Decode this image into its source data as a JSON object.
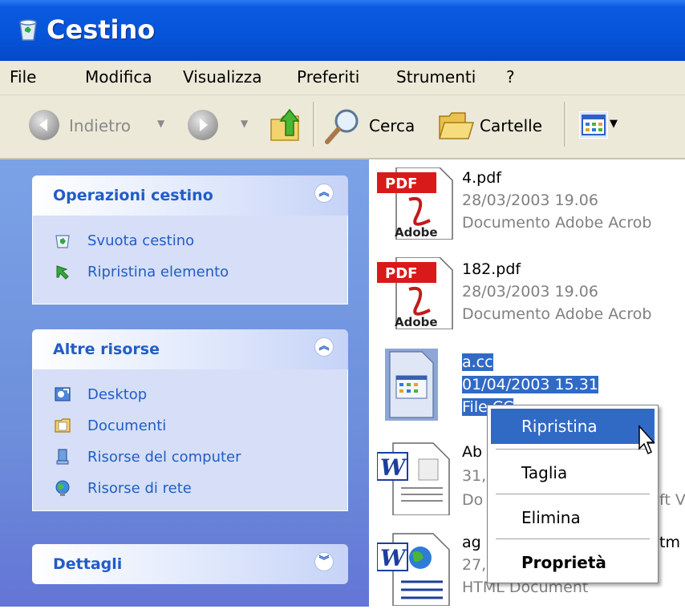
{
  "window": {
    "title": "Cestino"
  },
  "menu": [
    "File",
    "Modifica",
    "Visualizza",
    "Preferiti",
    "Strumenti",
    "?"
  ],
  "toolbar": {
    "back": "Indietro",
    "search": "Cerca",
    "folders": "Cartelle"
  },
  "panels": {
    "recycle": {
      "title": "Operazioni cestino",
      "tasks": [
        "Svuota cestino",
        "Ripristina elemento"
      ]
    },
    "other": {
      "title": "Altre risorse",
      "links": [
        "Desktop",
        "Documenti",
        "Risorse del computer",
        "Risorse di rete"
      ]
    },
    "details": {
      "title": "Dettagli"
    }
  },
  "files": [
    {
      "name": "4.pdf",
      "date": "28/03/2003 19.06",
      "type": "Documento Adobe Acrob"
    },
    {
      "name": "182.pdf",
      "date": "28/03/2003 19.06",
      "type": "Documento Adobe Acrob"
    },
    {
      "name": "a.cc",
      "date": "01/04/2003 15.31",
      "type": "File CC"
    },
    {
      "name": "Ab",
      "date": "31,",
      "type": "Do",
      "type_tail": "ft V"
    },
    {
      "name": "ag",
      "name_tail": "tm",
      "date": "27,",
      "type": "HTML Document"
    }
  ],
  "context_menu": {
    "items": [
      "Ripristina",
      "Taglia",
      "Elimina",
      "Proprietà"
    ],
    "highlighted": "Ripristina",
    "default": "Proprietà"
  },
  "colors": {
    "titlebar": "#0654d8",
    "selection": "#316ac5",
    "task_link": "#215dc6",
    "panel_body": "#d6dff7"
  }
}
